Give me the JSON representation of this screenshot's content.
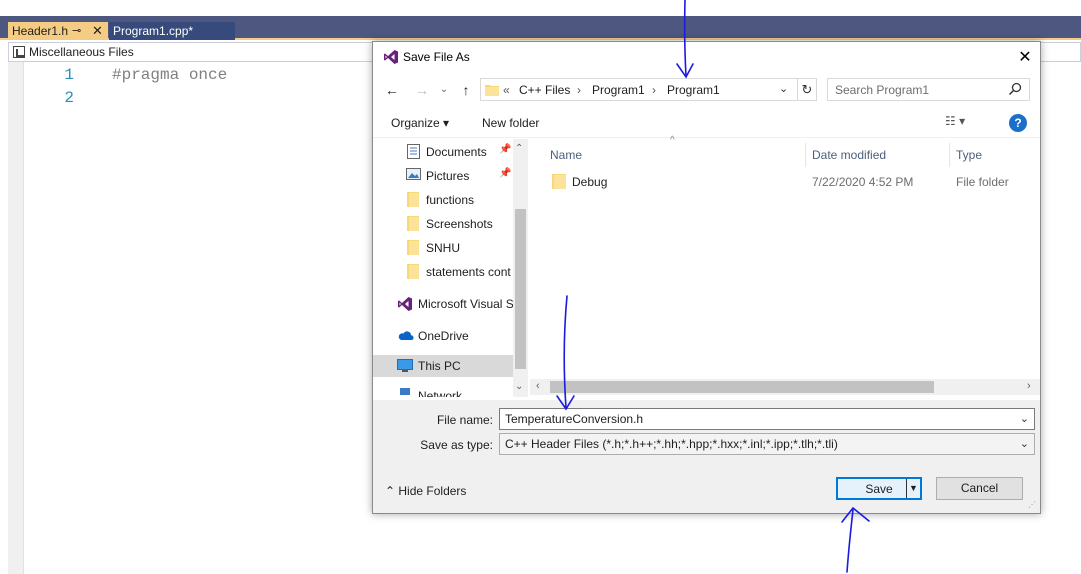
{
  "vs": {
    "tabs": [
      {
        "label": "Header1.h",
        "pin": "⊸",
        "close": "✕"
      },
      {
        "label": "Program1.cpp*"
      }
    ],
    "nav_scope": "Miscellaneous Files",
    "code_lines": [
      {
        "num": "1",
        "text": "#pragma once"
      },
      {
        "num": "2",
        "text": ""
      }
    ]
  },
  "dialog": {
    "title": "Save File As",
    "close": "✕",
    "address": {
      "overflow": "«",
      "crumbs": [
        "C++ Files",
        "Program1",
        "Program1"
      ],
      "separator": "›"
    },
    "search_placeholder": "Search Program1",
    "toolbar": {
      "organize": "Organize ▾",
      "new_folder": "New folder",
      "views": "☷ ▾",
      "help": "?"
    },
    "nav_pane": [
      {
        "label": "Documents",
        "icon": "documents-icon",
        "pinned": true
      },
      {
        "label": "Pictures",
        "icon": "pictures-icon",
        "pinned": true
      },
      {
        "label": "functions",
        "icon": "folder-icon"
      },
      {
        "label": "Screenshots",
        "icon": "folder-icon"
      },
      {
        "label": "SNHU",
        "icon": "folder-icon"
      },
      {
        "label": "statements cont",
        "icon": "folder-icon"
      },
      {
        "label": "Microsoft Visual S",
        "icon": "visual-studio-icon"
      },
      {
        "label": "OneDrive",
        "icon": "onedrive-icon"
      },
      {
        "label": "This PC",
        "icon": "this-pc-icon",
        "selected": true
      },
      {
        "label": "Network",
        "icon": "network-icon"
      }
    ],
    "columns": {
      "name": "Name",
      "date": "Date modified",
      "type": "Type"
    },
    "files": [
      {
        "name": "Debug",
        "date": "7/22/2020 4:52 PM",
        "type": "File folder"
      }
    ],
    "file_name_label": "File name:",
    "file_name_value": "TemperatureConversion.h",
    "save_as_type_label": "Save as type:",
    "save_as_type_value": "C++ Header Files (*.h;*.h++;*.hh;*.hpp;*.hxx;*.inl;*.ipp;*.tlh;*.tli)",
    "hide_folders": "Hide Folders",
    "save": "Save",
    "cancel": "Cancel"
  },
  "colors": {
    "vs_tab_active": "#f5cc84",
    "vs_tabstrip": "#4d5780",
    "accent": "#0078d7",
    "annotation_ink": "#1a1ae0"
  }
}
